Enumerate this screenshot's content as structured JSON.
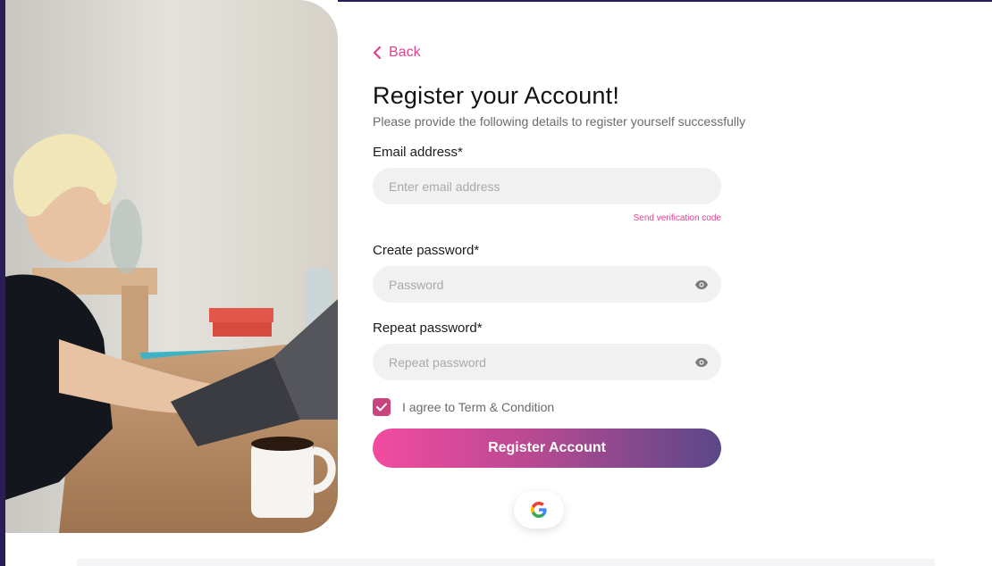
{
  "back": {
    "label": "Back"
  },
  "header": {
    "title": "Register your Account!",
    "subtitle": "Please provide the following details to register yourself successfully"
  },
  "email": {
    "label": "Email address*",
    "placeholder": "Enter email address",
    "value": "",
    "send_code_label": "Send verification code"
  },
  "password": {
    "label": "Create password*",
    "placeholder": "Password",
    "value": ""
  },
  "repeat_password": {
    "label": "Repeat password*",
    "placeholder": "Repeat password",
    "value": ""
  },
  "terms": {
    "label": "I agree to Term & Condition",
    "checked": true
  },
  "register_button": {
    "label": "Register Account"
  },
  "social": {
    "icon": "google-icon"
  },
  "colors": {
    "accent": "#e23f8f",
    "checkbox": "#c8447f",
    "gradient_start": "#f24ba0",
    "gradient_end": "#5a4888",
    "backdrop": "#2a1c57"
  }
}
